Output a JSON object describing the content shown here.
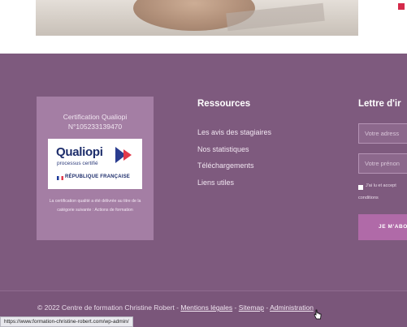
{
  "certification": {
    "title": "Certification Qualiopi",
    "number": "N°105233139470",
    "logo_word": "Qualiopi",
    "logo_subtitle": "processus certifié",
    "logo_republic": "RÉPUBLIQUE FRANÇAISE",
    "text": "La certification qualité a été délivrée au titre de la catégorie suivante : Actions de formation"
  },
  "resources": {
    "heading": "Ressources",
    "links": [
      "Les avis des stagiaires",
      "Nos statistiques",
      "Téléchargements",
      "Liens utiles"
    ]
  },
  "newsletter": {
    "heading": "Lettre d'ir",
    "email_placeholder": "Votre adress",
    "firstname_placeholder": "Votre prénon",
    "terms_line1": "J'ai lu et accept",
    "terms_line2": "conditions",
    "button_label": "JE M'ABO"
  },
  "footer_bottom": {
    "copyright": "© 2022 Centre de formation Christine Robert -",
    "link_legal": "Mentions légales",
    "sep1": "-",
    "link_sitemap": "Sitemap",
    "sep2": "-",
    "link_admin": "Administration"
  },
  "status_bar": {
    "url": "https://www.formation-christine-robert.com/wp-admin/"
  },
  "colors": {
    "footer_bg": "#7e5a7e",
    "card_bg": "#a47ea4",
    "button_bg": "#b06aa8"
  },
  "icons": [
    "qualiopi-logo",
    "french-flag-icon",
    "hand-cursor-icon"
  ]
}
